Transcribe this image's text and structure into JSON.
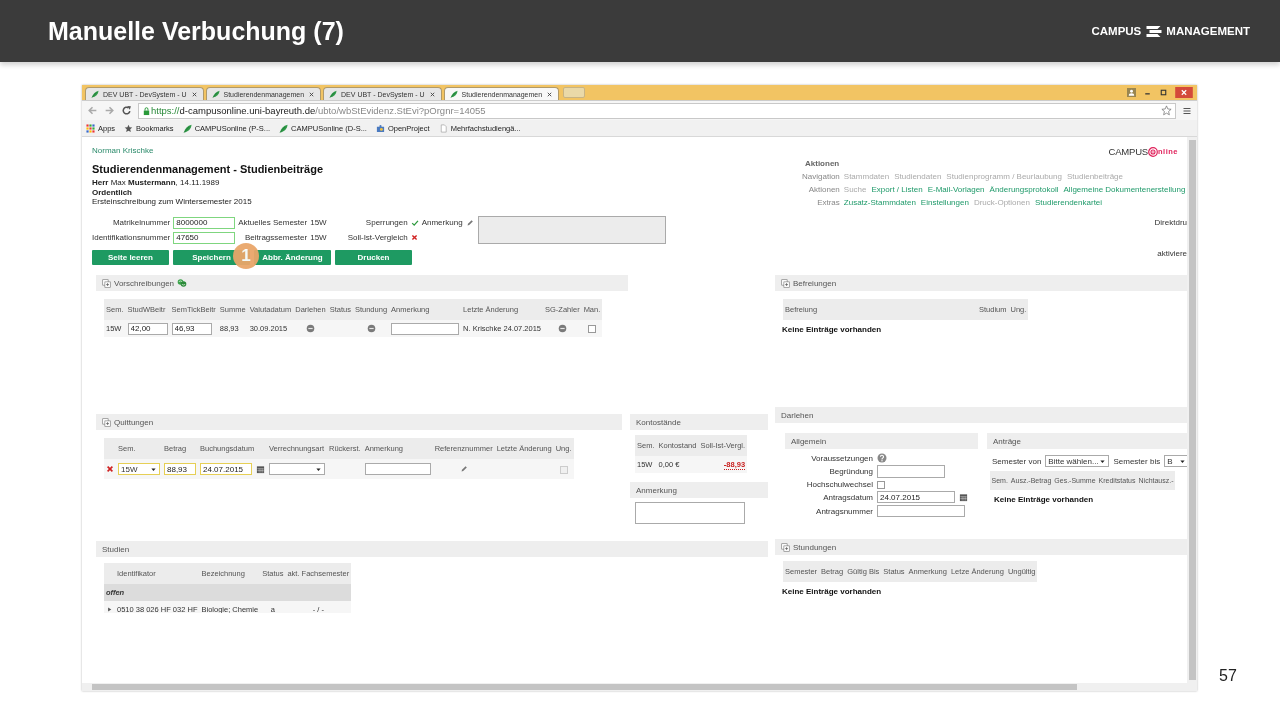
{
  "slide": {
    "title": "Manuelle Verbuchung (7)",
    "logo": {
      "left": "CAMPUS",
      "right": "MANAGEMENT"
    },
    "page_number": "57"
  },
  "browser": {
    "tabs": [
      {
        "label": "DEV UBT - DevSystem - U",
        "selected": false
      },
      {
        "label": "Studierendenmanagemen",
        "selected": false
      },
      {
        "label": "DEV UBT - DevSystem - U",
        "selected": false
      },
      {
        "label": "Studierendenmanagemen",
        "selected": true
      }
    ],
    "url": {
      "scheme": "https://",
      "host": "d-campusonline.uni-bayreuth.de",
      "path": "/ubto/wbStEvidenz.StEvi?pOrgnr=14055"
    },
    "bookmarks": [
      {
        "kind": "apps",
        "label": "Apps"
      },
      {
        "kind": "star",
        "label": "Bookmarks"
      },
      {
        "kind": "leaf",
        "label": "CAMPUSonline (P-S..."
      },
      {
        "kind": "leaf",
        "label": "CAMPUSonline (D-S..."
      },
      {
        "kind": "puzzle",
        "label": "OpenProject"
      },
      {
        "kind": "page",
        "label": "Mehrfachstudiengä..."
      }
    ]
  },
  "page": {
    "user": "Norman Krischke",
    "logo": {
      "left": "CAMPUS",
      "right": "nline"
    },
    "heading": "Studierendenmanagement - Studienbeiträge",
    "person": "**Herr** Max **Mustermann**, 14.11.1989",
    "status": "Ordentlich",
    "enrollment": "Ersteinschreibung zum Wintersemester 2015",
    "actions": {
      "title": "Aktionen",
      "rows": [
        {
          "label": "Navigation",
          "links": [
            {
              "text": "Stammdaten",
              "enabled": false
            },
            {
              "text": "Studiendaten",
              "enabled": false
            },
            {
              "text": "Studienprogramm / Beurlaubung",
              "enabled": false
            },
            {
              "text": "Studienbeiträge",
              "enabled": false
            }
          ]
        },
        {
          "label": "Aktionen",
          "links": [
            {
              "text": "Suche",
              "enabled": false
            },
            {
              "text": "Export / Listen",
              "enabled": true
            },
            {
              "text": "E-Mail-Vorlagen",
              "enabled": true
            },
            {
              "text": "Änderungsprotokoll",
              "enabled": true
            },
            {
              "text": "Allgemeine Dokumentenerstellung",
              "enabled": true
            }
          ]
        },
        {
          "label": "Extras",
          "links": [
            {
              "text": "Zusatz-Stammdaten",
              "enabled": true
            },
            {
              "text": "Einstellungen",
              "enabled": true
            },
            {
              "text": "Druck-Optionen",
              "enabled": false
            },
            {
              "text": "Studierendenkartei",
              "enabled": true
            }
          ]
        }
      ]
    },
    "ids": [
      {
        "label": "Matrikelnummer",
        "value": "8000000",
        "valid": true
      },
      {
        "label": "Identifikationsnummer",
        "value": "47650",
        "valid": true
      }
    ],
    "semesters": [
      {
        "label": "Aktuelles Semester",
        "value": "15W"
      },
      {
        "label": "Beitragssemester",
        "value": "15W"
      }
    ],
    "checks": [
      {
        "label": "Sperrungen",
        "ok": true
      },
      {
        "label": "Soll-Ist-Vergleich",
        "ok": false
      }
    ],
    "note": {
      "label": "Anmerkung"
    },
    "side_labels": [
      "Direktdru",
      "aktiviere"
    ],
    "buttons": [
      "Seite leeren",
      "Speichern",
      "Abbr. Änderung",
      "Drucken"
    ],
    "callout": "1",
    "prescriptions": {
      "title": "Vorschreibungen",
      "collapsible": true,
      "refresh": true,
      "table": {
        "columns": [
          "Sem.",
          "StudWBeitr",
          "SemTickBeitr",
          "Summe",
          "Valutadatum",
          "Darlehen",
          "Status",
          "Stundung",
          "Anmerkung",
          "Letzte Änderung",
          "SG-Zahler",
          "Man."
        ],
        "rows": [
          {
            "cells": [
              {
                "kind": "text",
                "text": "15W"
              },
              {
                "kind": "input",
                "value": "42,00"
              },
              {
                "kind": "input",
                "value": "46,93"
              },
              {
                "kind": "text",
                "text": "88,93"
              },
              {
                "kind": "text",
                "text": "30.09.2015"
              },
              {
                "kind": "dot"
              },
              {
                "kind": "empty"
              },
              {
                "kind": "dot"
              },
              {
                "kind": "input"
              },
              {
                "kind": "text",
                "text": "N. Krischke 24.07.2015"
              },
              {
                "kind": "dot"
              },
              {
                "kind": "checkbox",
                "checked": false,
                "disabled": false
              }
            ]
          }
        ]
      }
    },
    "receipts": {
      "title": "Quittungen",
      "collapsible": true,
      "table": {
        "columns": [
          "Sem.",
          "Betrag",
          "Buchungsdatum",
          "Verrechnungsart",
          "Rückerst.",
          "Anmerkung",
          "Referenznummer",
          "Letzte Änderung",
          "Ung."
        ],
        "rows": [
          {
            "deletable": true,
            "cells": [
              {
                "kind": "select",
                "value": "15W",
                "highlighted": true
              },
              {
                "kind": "input",
                "value": "88,93",
                "highlighted": true
              },
              {
                "kind": "date",
                "value": "24.07.2015",
                "highlighted": true
              },
              {
                "kind": "select",
                "highlighted": false
              },
              {
                "kind": "empty"
              },
              {
                "kind": "input",
                "highlighted": false
              },
              {
                "kind": "pencil"
              },
              {
                "kind": "empty"
              },
              {
                "kind": "checkbox",
                "checked": false,
                "disabled": true
              }
            ]
          }
        ]
      }
    },
    "balances": {
      "title": "Kontostände",
      "collapsible": false,
      "table": {
        "columns": [
          "Sem.",
          "Kontostand",
          "Soll-Ist-Vergl."
        ],
        "rows": [
          {
            "cells": [
              {
                "kind": "text",
                "text": "15W"
              },
              {
                "kind": "text",
                "text": "0,00 €"
              },
              {
                "kind": "negative",
                "text": "-88,93"
              }
            ]
          }
        ]
      }
    },
    "remark": {
      "title": "Anmerkung",
      "collapsible": false
    },
    "studies": {
      "title": "Studien",
      "collapsible": false,
      "table": {
        "columns": [
          "Identifikator",
          "Bezeichnung",
          "Status",
          "akt. Fachsemester"
        ],
        "groups": [
          {
            "label": "offen",
            "rows": [
              {
                "expanded": false,
                "cells": [
                  {
                    "kind": "text",
                    "text": "0510 38 026 HF 032 HF"
                  },
                  {
                    "kind": "text",
                    "text": "Biologie; Chemie"
                  },
                  {
                    "kind": "abbr",
                    "text": "a"
                  },
                  {
                    "kind": "abbr",
                    "text": "- / -"
                  }
                ]
              }
            ]
          }
        ]
      }
    },
    "exemptions": {
      "title": "Befreiungen",
      "collapsible": true,
      "table": {
        "columns": [
          "Befreiung",
          "Studium",
          "Ung."
        ],
        "empty": "Keine Einträge vorhanden"
      }
    },
    "loans": {
      "title": "Darlehen",
      "collapsible": false,
      "general": {
        "title": "Allgemein",
        "fields": [
          {
            "kind": "help",
            "label": "Voraussetzungen"
          },
          {
            "kind": "textarea",
            "label": "Begründung"
          },
          {
            "kind": "checkbox",
            "label": "Hochschulwechsel",
            "checked": false
          },
          {
            "kind": "date",
            "label": "Antragsdatum",
            "value": "24.07.2015"
          },
          {
            "kind": "input",
            "label": "Antragsnummer"
          }
        ]
      },
      "applications": {
        "title": "Anträge",
        "filters": [
          {
            "label": "Semester von",
            "value": "Bitte wählen..."
          },
          {
            "label": "Semester bis",
            "value": "B"
          }
        ],
        "table": {
          "columns": [
            "Sem.",
            "Ausz.-Betrag",
            "Ges.-Summe",
            "Kreditstatus",
            "Nichtausz.-"
          ],
          "empty": "Keine Einträge vorhanden"
        }
      }
    },
    "deferrals": {
      "title": "Stundungen",
      "collapsible": true,
      "table": {
        "columns": [
          "Semester",
          "Betrag",
          "Gültig Bis",
          "Status",
          "Anmerkung",
          "Letze Änderung",
          "Ungültig"
        ],
        "empty": "Keine Einträge vorhanden"
      }
    }
  }
}
